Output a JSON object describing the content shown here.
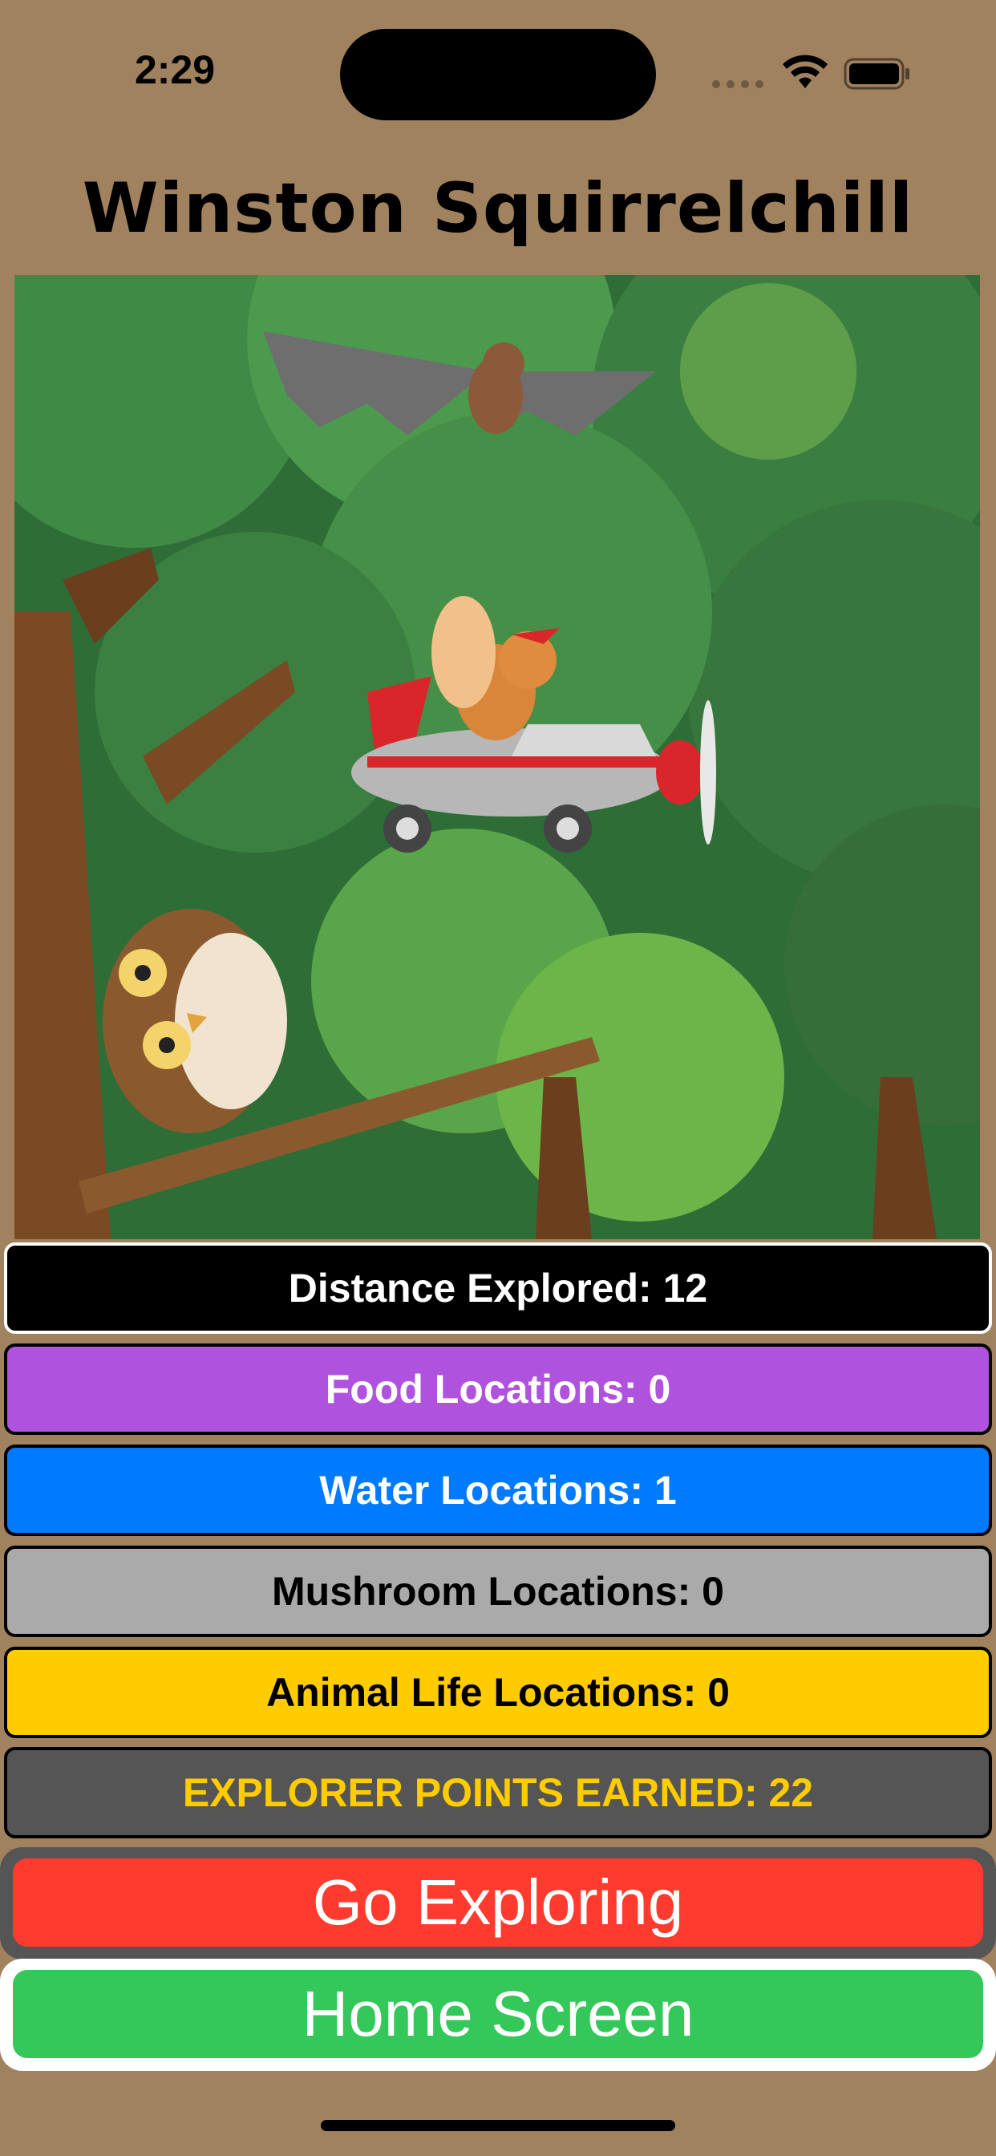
{
  "status_bar": {
    "time": "2:29",
    "icons": [
      "signal-dots-icon",
      "wifi-icon",
      "battery-icon"
    ]
  },
  "title": "Winston Squirrelchill",
  "scene": {
    "characters": [
      "bat",
      "squirrel-in-airplane",
      "owl"
    ],
    "background": "forest"
  },
  "stats": [
    {
      "label": "Distance Explored: 12",
      "bg": "#000000",
      "color": "#ffffff",
      "name": "distance-explored"
    },
    {
      "label": "Food Locations: 0",
      "bg": "#af52de",
      "color": "#ffffff",
      "name": "food-locations"
    },
    {
      "label": "Water Locations: 1",
      "bg": "#007aff",
      "color": "#ffffff",
      "name": "water-locations"
    },
    {
      "label": "Mushroom Locations: 0",
      "bg": "#aaaaaa",
      "color": "#000000",
      "name": "mushroom-locations"
    },
    {
      "label": "Animal Life Locations: 0",
      "bg": "#ffcc00",
      "color": "#000000",
      "name": "animal-life-locations"
    },
    {
      "label": "EXPLORER POINTS EARNED: 22",
      "bg": "#555555",
      "color": "#ffcc00",
      "name": "explorer-points"
    }
  ],
  "buttons": {
    "go_exploring": "Go Exploring",
    "home_screen": "Home Screen"
  },
  "colors": {
    "background": "#a0825f",
    "go_exploring": "#ff3b30",
    "home_screen": "#34c759"
  }
}
